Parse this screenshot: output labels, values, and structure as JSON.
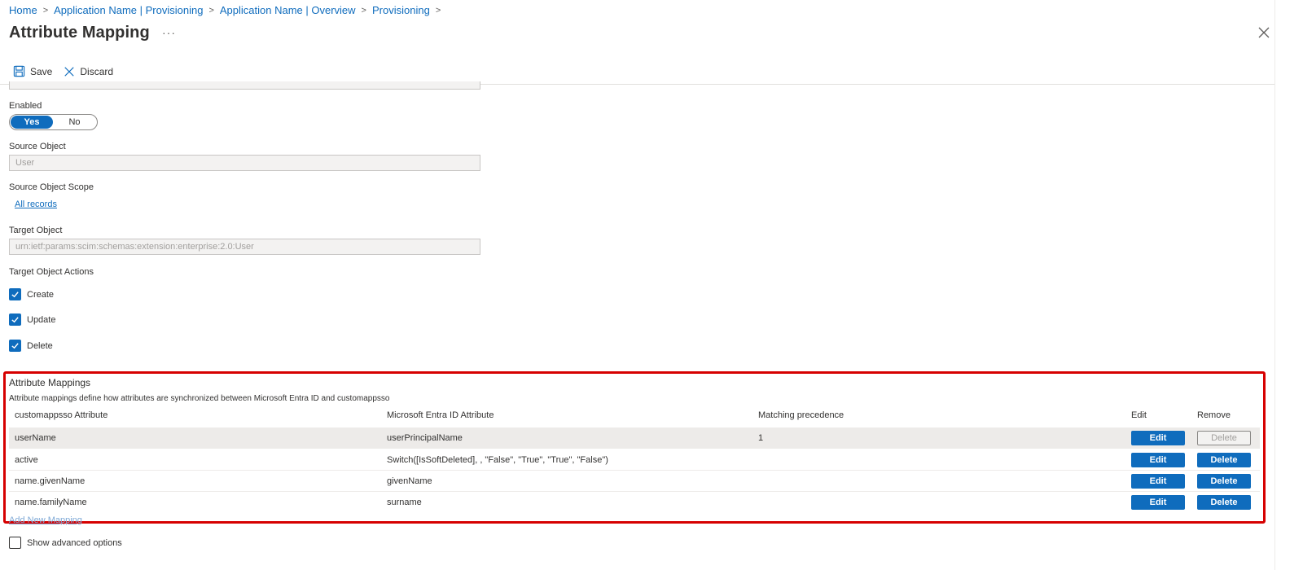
{
  "breadcrumb": [
    "Home",
    "Application Name | Provisioning",
    "Application Name | Overview",
    "Provisioning"
  ],
  "page": {
    "title": "Attribute Mapping",
    "more": "···"
  },
  "toolbar": {
    "save": "Save",
    "discard": "Discard"
  },
  "form": {
    "enabled_label": "Enabled",
    "toggle_yes": "Yes",
    "toggle_no": "No",
    "source_object_label": "Source Object",
    "source_object_value": "User",
    "source_scope_label": "Source Object Scope",
    "source_scope_link": "All records",
    "target_object_label": "Target Object",
    "target_object_value": "urn:ietf:params:scim:schemas:extension:enterprise:2.0:User",
    "target_actions_label": "Target Object Actions",
    "actions": [
      "Create",
      "Update",
      "Delete"
    ]
  },
  "mappings": {
    "title": "Attribute Mappings",
    "description": "Attribute mappings define how attributes are synchronized between Microsoft Entra ID and customappsso",
    "headers": {
      "source": "customappsso Attribute",
      "target": "Microsoft Entra ID Attribute",
      "precedence": "Matching precedence",
      "edit": "Edit",
      "remove": "Remove"
    },
    "rows": [
      {
        "source": "userName",
        "target": "userPrincipalName",
        "precedence": "1",
        "edit": "Edit",
        "delete": "Delete"
      },
      {
        "source": "active",
        "target": "Switch([IsSoftDeleted], , \"False\", \"True\", \"True\", \"False\")",
        "precedence": "",
        "edit": "Edit",
        "delete": "Delete"
      },
      {
        "source": "name.givenName",
        "target": "givenName",
        "precedence": "",
        "edit": "Edit",
        "delete": "Delete"
      },
      {
        "source": "name.familyName",
        "target": "surname",
        "precedence": "",
        "edit": "Edit",
        "delete": "Delete"
      }
    ],
    "add_new": "Add New Mapping"
  },
  "advanced": {
    "label": "Show advanced options"
  },
  "colors": {
    "accent": "#0f6cbd",
    "highlight": "#d60000"
  }
}
